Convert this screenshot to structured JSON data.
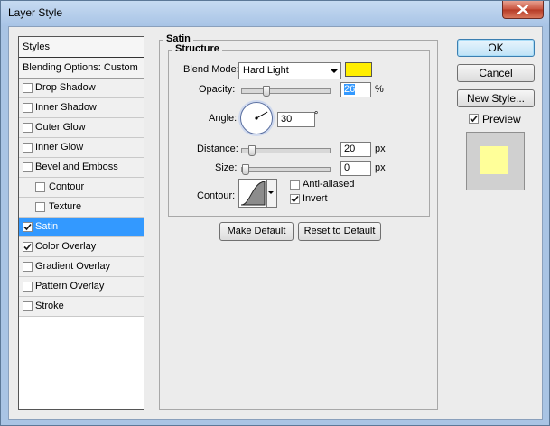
{
  "window": {
    "title": "Layer Style"
  },
  "styles": {
    "header": "Styles",
    "blending": "Blending Options: Custom",
    "items": [
      {
        "label": "Drop Shadow",
        "checked": false,
        "sub": false,
        "selected": false
      },
      {
        "label": "Inner Shadow",
        "checked": false,
        "sub": false,
        "selected": false
      },
      {
        "label": "Outer Glow",
        "checked": false,
        "sub": false,
        "selected": false
      },
      {
        "label": "Inner Glow",
        "checked": false,
        "sub": false,
        "selected": false
      },
      {
        "label": "Bevel and Emboss",
        "checked": false,
        "sub": false,
        "selected": false
      },
      {
        "label": "Contour",
        "checked": false,
        "sub": true,
        "selected": false
      },
      {
        "label": "Texture",
        "checked": false,
        "sub": true,
        "selected": false
      },
      {
        "label": "Satin",
        "checked": true,
        "sub": false,
        "selected": true
      },
      {
        "label": "Color Overlay",
        "checked": true,
        "sub": false,
        "selected": false
      },
      {
        "label": "Gradient Overlay",
        "checked": false,
        "sub": false,
        "selected": false
      },
      {
        "label": "Pattern Overlay",
        "checked": false,
        "sub": false,
        "selected": false
      },
      {
        "label": "Stroke",
        "checked": false,
        "sub": false,
        "selected": false
      }
    ]
  },
  "satin": {
    "title": "Satin",
    "structure_title": "Structure",
    "blend_mode_label": "Blend Mode:",
    "blend_mode_value": "Hard Light",
    "blend_color": "#ffee00",
    "opacity_label": "Opacity:",
    "opacity_value": "26",
    "opacity_level": 0.26,
    "percent_unit": "%",
    "angle_label": "Angle:",
    "angle_value": "30",
    "degree_unit": "°",
    "distance_label": "Distance:",
    "distance_value": "20",
    "distance_level": 0.08,
    "size_label": "Size:",
    "size_value": "0",
    "size_level": 0,
    "px_unit": "px",
    "contour_label": "Contour:",
    "anti_aliased_label": "Anti-aliased",
    "anti_aliased_checked": false,
    "invert_label": "Invert",
    "invert_checked": true,
    "make_default_label": "Make Default",
    "reset_default_label": "Reset to Default"
  },
  "side": {
    "ok_label": "OK",
    "cancel_label": "Cancel",
    "new_style_label": "New Style...",
    "preview_label": "Preview",
    "preview_checked": true,
    "preview_color": "#ffff99"
  },
  "icons": {
    "close": "close-icon",
    "check": "checkmark-icon",
    "contour": "contour-curve-icon",
    "dial": "angle-dial-icon"
  }
}
